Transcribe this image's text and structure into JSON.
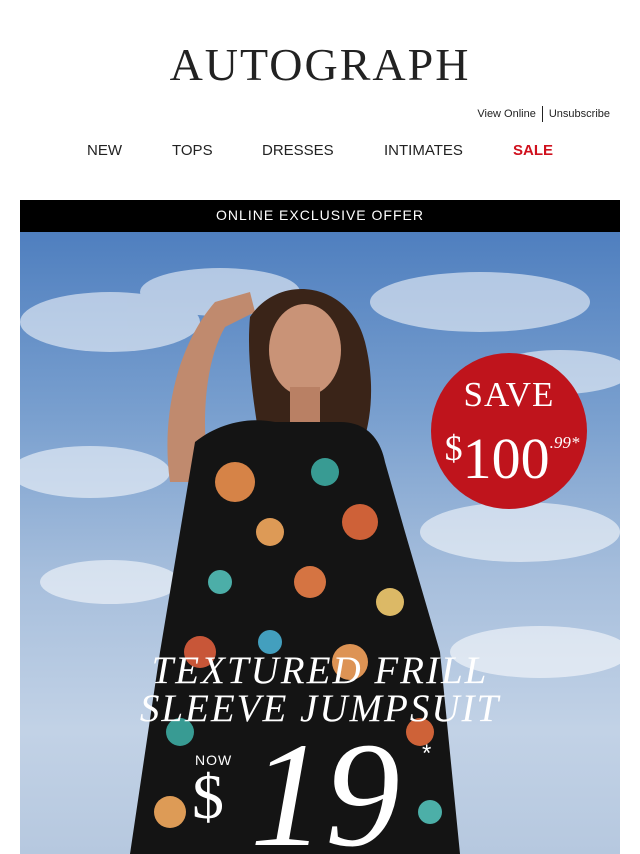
{
  "header": {
    "logo": "AUTOGRAPH",
    "view_online": "View Online",
    "unsubscribe": "Unsubscribe"
  },
  "nav": {
    "items": [
      {
        "label": "NEW"
      },
      {
        "label": "TOPS"
      },
      {
        "label": "DRESSES"
      },
      {
        "label": "INTIMATES"
      },
      {
        "label": "SALE"
      }
    ],
    "sale_color": "#d0101d"
  },
  "offer_bar": {
    "text": "ONLINE EXCLUSIVE OFFER"
  },
  "hero": {
    "badge": {
      "save": "SAVE",
      "currency": "$",
      "amount": "100",
      "cents": ".99*",
      "color": "#bf141c"
    },
    "title_line1": "TEXTURED FRILL",
    "title_line2": "SLEEVE JUMPSUIT",
    "now_label": "NOW",
    "price_currency": "$",
    "price": "19",
    "price_asterisk": "*"
  }
}
